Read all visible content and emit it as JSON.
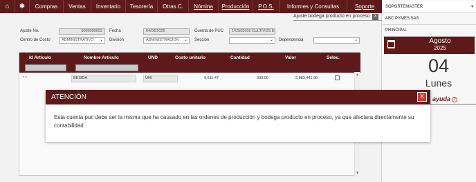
{
  "menu": {
    "home_icon": "home-icon",
    "settings_icon": "gear-icon",
    "items": [
      "Compras",
      "Ventas",
      "Inventario",
      "Tesorería",
      "Otras C.",
      "Nómina",
      "Producción",
      "P.O.S.",
      "Informes y Consultas",
      "Soporte"
    ]
  },
  "screen": {
    "title": "Ajuste bodega producto en proceso",
    "close_label": "X"
  },
  "form": {
    "ajuste_no_label": "Ajuste No.",
    "ajuste_no_value": "0000000002",
    "fecha_label": "Fecha",
    "fecha_value": "04/08/2025",
    "cuenta_puc_label": "Cuenta de PUC",
    "cuenta_puc_value": "142505005 CULTIVOS EN",
    "centro_costo_label": "Centro de Costo",
    "centro_costo_value": "ADMINISTRATIVO",
    "division_label": "División",
    "division_value": "ADMINISTRACION",
    "seccion_label": "Sección",
    "seccion_value": "",
    "dependencia_label": "Dependencia",
    "dependencia_value": ""
  },
  "grid": {
    "headers": [
      "Id Artículo",
      "Nombre Artículo",
      "UND",
      "Costo unitario",
      "Cantidad",
      "Valor",
      "Selec."
    ],
    "rows": [
      {
        "id": "* *",
        "nombre": "BESIDA",
        "und": "UNI",
        "costo": "9,611.47",
        "cantidad": "300.00",
        "valor": "2,883,441.00"
      }
    ]
  },
  "user_panel": {
    "user": "SOPORTEMASTER",
    "company": "ABC PYMES SAS",
    "branch": "PRINCIPAL",
    "month": "Agosto",
    "year": "2025",
    "day": "04",
    "weekday": "Lunes",
    "help": "ayuda"
  },
  "modal": {
    "title": "ATENCIÓN",
    "close_label": "X",
    "message": "Esta cuenta puc debe ser la misma que ha causado en las ordenes de producción y bodega producto en proceso, ya que afectara directamente su contabilidad"
  },
  "colors": {
    "primary": "#5e1a1a",
    "close_red": "#d23b2a"
  }
}
